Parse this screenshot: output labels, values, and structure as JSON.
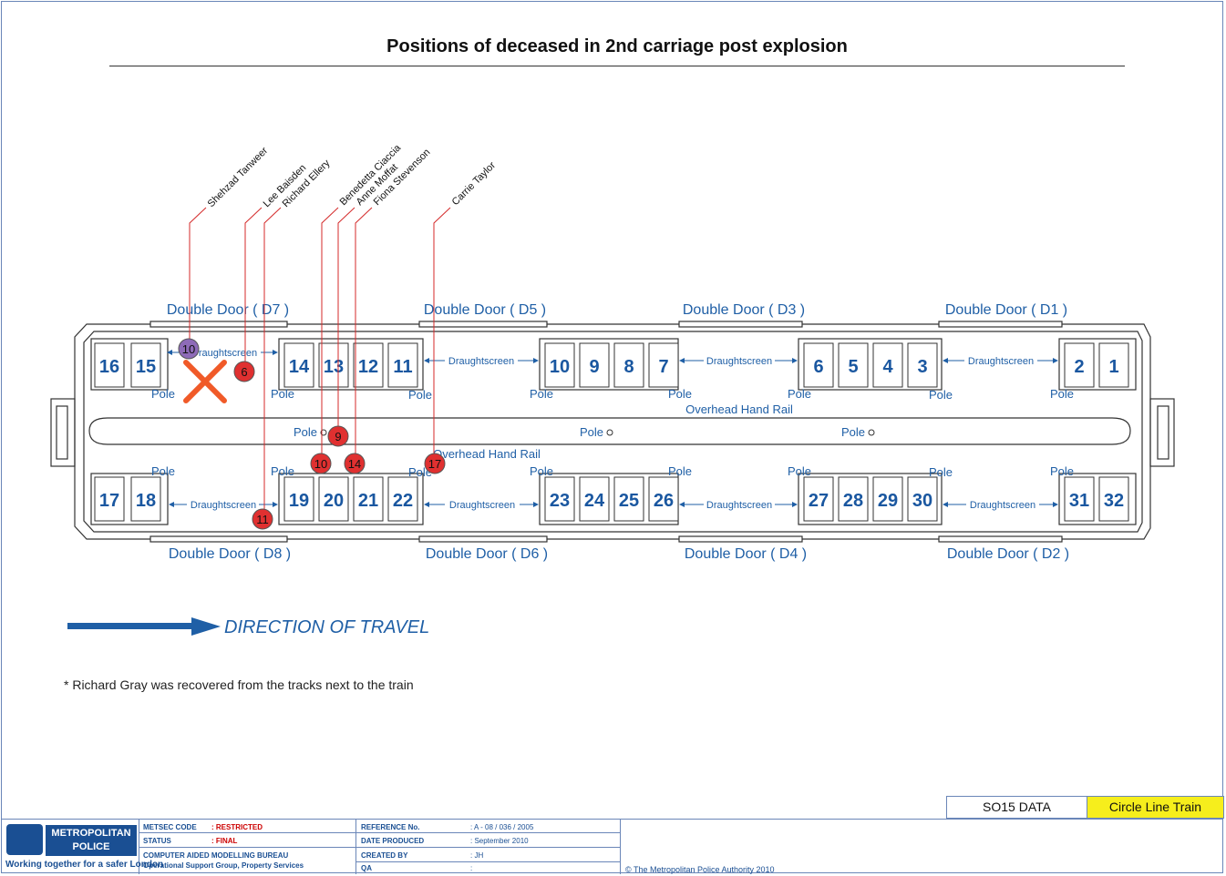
{
  "title": "Positions of deceased in 2nd carriage post explosion",
  "doors_top": [
    "Double Door ( D7 )",
    "Double Door ( D5 )",
    "Double Door ( D3 )",
    "Double Door ( D1 )"
  ],
  "doors_bottom": [
    "Double Door ( D8 )",
    "Double Door ( D6 )",
    "Double Door ( D4 )",
    "Double Door ( D2 )"
  ],
  "seats_top": [
    "16",
    "15",
    "14",
    "13",
    "12",
    "11",
    "10",
    "9",
    "8",
    "7",
    "6",
    "5",
    "4",
    "3",
    "2",
    "1"
  ],
  "seats_bottom": [
    "17",
    "18",
    "19",
    "20",
    "21",
    "22",
    "23",
    "24",
    "25",
    "26",
    "27",
    "28",
    "29",
    "30",
    "31",
    "32"
  ],
  "labels": {
    "draughtscreen": "Draughtscreen",
    "pole": "Pole",
    "overhead_rail": "Overhead Hand Rail"
  },
  "victims": [
    {
      "name": "Shehzad Tanweer",
      "marker": "10",
      "color": "#8e6bb8"
    },
    {
      "name": "Lee Baisden",
      "marker": "6",
      "color": "#e03030"
    },
    {
      "name": "Richard Ellery",
      "marker": "11",
      "color": "#e03030"
    },
    {
      "name": "Benedetta Ciaccia",
      "marker": "10",
      "color": "#e03030"
    },
    {
      "name": "Anne Moffat",
      "marker": "9",
      "color": "#e03030"
    },
    {
      "name": "Fiona Stevenson",
      "marker": "14",
      "color": "#e03030"
    },
    {
      "name": "Carrie Taylor",
      "marker": "17",
      "color": "#e03030"
    }
  ],
  "explosion_marker_color": "#f05a28",
  "direction": "DIRECTION OF TRAVEL",
  "footnote": "* Richard Gray was recovered from the tracks next to the train",
  "footer": {
    "so15": "SO15 DATA",
    "train": "Circle Line Train",
    "logo_line1": "METROPOLITAN",
    "logo_line2": "POLICE",
    "logo_tag": "Working together for a safer London",
    "metsec_label": "METSEC CODE",
    "metsec_value": ": RESTRICTED",
    "status_label": "STATUS",
    "status_value": ": FINAL",
    "bureau": "COMPUTER AIDED MODELLING BUREAU",
    "group": "Operational Support Group, Property Services",
    "ref_label": "REFERENCE No.",
    "ref_value": ": A - 08 / 036 / 2005",
    "date_label": "DATE PRODUCED",
    "date_value": ": September 2010",
    "created_label": "CREATED BY",
    "created_value": ": JH",
    "qa_label": "QA",
    "qa_value": ":",
    "copyright": "© The Metropolitan Police Authority 2010"
  }
}
